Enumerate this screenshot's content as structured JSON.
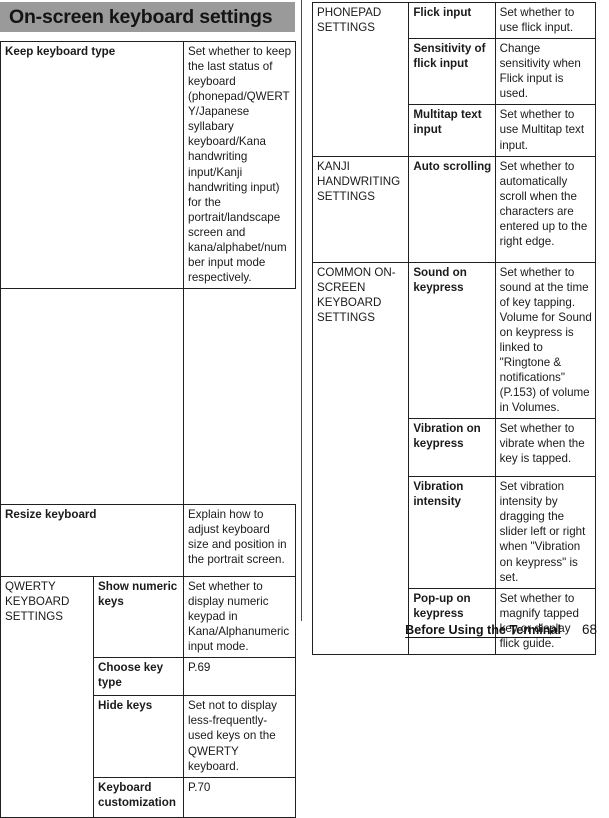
{
  "document": {
    "section_banner": "On-screen keyboard settings",
    "footer_label": "Before Using the Terminal",
    "page_number": "68",
    "banner_color": "#9a9a9a",
    "rule_color": "#202020"
  },
  "left_table": {
    "rows": [
      {
        "kind": "two-col",
        "item": "Keep keyboard type",
        "desc": "Set whether to keep the last status of keyboard (phonepad/QWERTY/Japanese syllabary keyboard/Kana handwriting input/Kanji handwriting input) for the portrait/landscape screen and kana/alphabet/number input mode respectively."
      },
      {
        "kind": "two-col",
        "item": "Resize keyboard",
        "desc": "Explain how to adjust keyboard size and position in the portrait screen."
      },
      {
        "kind": "three-col",
        "category": "QWERTY KEYBOARD SETTINGS",
        "category_rowspan": 4,
        "item": "Show numeric keys",
        "desc": "Set whether to display numeric keypad in Kana/Alphanumeric input mode."
      },
      {
        "kind": "three-col",
        "item": "Choose key type",
        "desc": "P.69"
      },
      {
        "kind": "three-col",
        "item": "Hide keys",
        "desc": "Set not to display less-frequently-used keys on the QWERTY keyboard."
      },
      {
        "kind": "three-col",
        "item": "Keyboard customization",
        "desc": "P.70"
      }
    ]
  },
  "right_table": {
    "rows": [
      {
        "category": "PHONEPAD SETTINGS",
        "category_rowspan": 3,
        "item": "Flick input",
        "desc": "Set whether to use flick input."
      },
      {
        "item": "Sensitivity of flick input",
        "desc": "Change sensitivity when Flick input is used."
      },
      {
        "item": "Multitap text input",
        "desc": "Set whether to use Multitap text input."
      },
      {
        "category": "KANJI HANDWRITING SETTINGS",
        "category_rowspan": 1,
        "item": "Auto scrolling",
        "desc": "Set whether to automatically scroll when the characters are entered up to the right edge."
      },
      {
        "category": "COMMON ON-SCREEN KEYBOARD SETTINGS",
        "category_rowspan": 4,
        "item": "Sound on keypress",
        "desc": "Set whether to sound at the time of key tapping. Volume for Sound on keypress is linked to \"Ringtone & notifications\" (P.153) of volume in Volumes."
      },
      {
        "item": "Vibration on keypress",
        "desc": "Set whether to vibrate when the key is tapped."
      },
      {
        "item": "Vibration intensity",
        "desc": "Set vibration intensity by dragging the slider left or right when \"Vibration on keypress\" is set."
      },
      {
        "item": "Pop-up on keypress",
        "desc": "Set whether to magnify tapped key or display flick guide."
      }
    ]
  }
}
